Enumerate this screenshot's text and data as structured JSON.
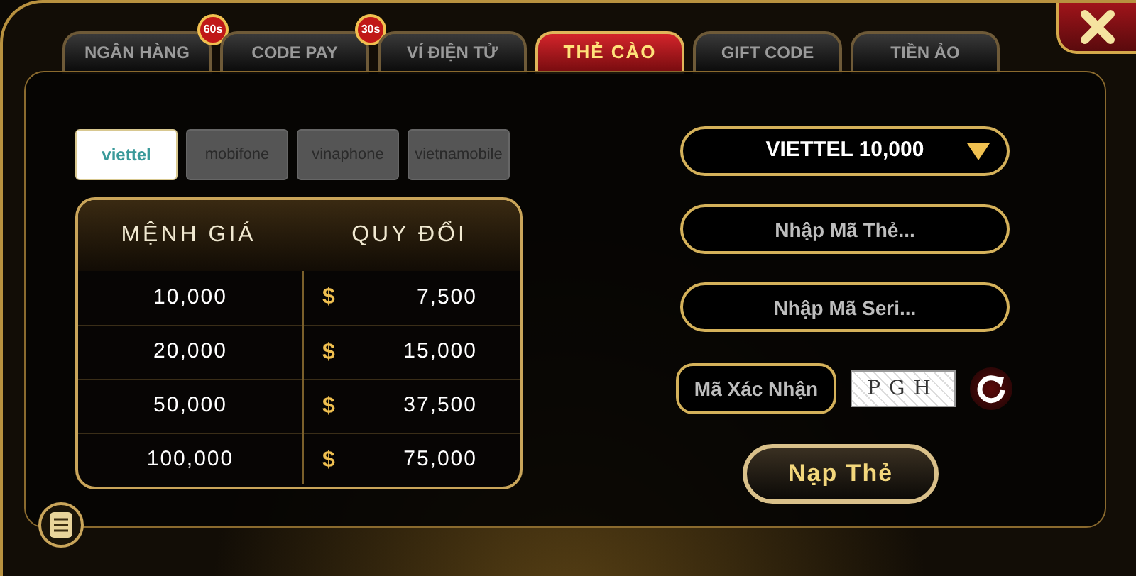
{
  "tabs": [
    {
      "label": "NGÂN HÀNG",
      "selected": false,
      "badge": "60s"
    },
    {
      "label": "CODE PAY",
      "selected": false,
      "badge": "30s"
    },
    {
      "label": "VÍ ĐIỆN TỬ",
      "selected": false
    },
    {
      "label": "THẺ CÀO",
      "selected": true
    },
    {
      "label": "GIFT CODE",
      "selected": false
    },
    {
      "label": "TIỀN ẢO",
      "selected": false
    }
  ],
  "carriers": [
    {
      "label": "viettel",
      "selected": true
    },
    {
      "label": "mobifone",
      "selected": false
    },
    {
      "label": "vinaphone",
      "selected": false
    },
    {
      "label": "vietnamobile",
      "selected": false
    }
  ],
  "rate_table": {
    "columns": [
      "MỆNH GIÁ",
      "QUY ĐỔI"
    ],
    "rows": [
      {
        "value": "10,000",
        "currency": "$",
        "exchange": "7,500"
      },
      {
        "value": "20,000",
        "currency": "$",
        "exchange": "15,000"
      },
      {
        "value": "50,000",
        "currency": "$",
        "exchange": "37,500"
      },
      {
        "value": "100,000",
        "currency": "$",
        "exchange": "75,000"
      }
    ]
  },
  "card_type": {
    "value": "VIETTEL 10,000"
  },
  "card_code": {
    "placeholder": "Nhập Mã Thẻ..."
  },
  "serial": {
    "placeholder": "Nhập Mã Seri..."
  },
  "captcha": {
    "placeholder": "Mã Xác Nhận",
    "code": "PGH"
  },
  "submit": "Nạp Thẻ"
}
